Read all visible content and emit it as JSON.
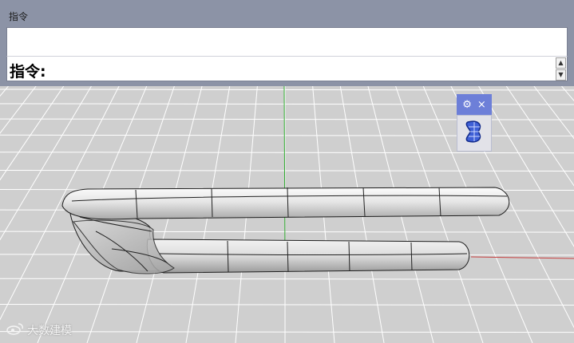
{
  "command_panel": {
    "title": "指令",
    "prompt_label": "指令:",
    "input_value": "",
    "spin_up": "▲",
    "spin_down": "▼"
  },
  "float_toolbar": {
    "gear_glyph": "⚙",
    "close_glyph": "×",
    "tool_icon": "sub-d-shape-icon"
  },
  "watermark": {
    "text": "大数建模"
  },
  "viewport": {
    "grid_color": "#ffffff",
    "background_color": "#cfcfcf",
    "y_axis_color": "#2faa2f",
    "x_axis_color": "#c84040"
  }
}
